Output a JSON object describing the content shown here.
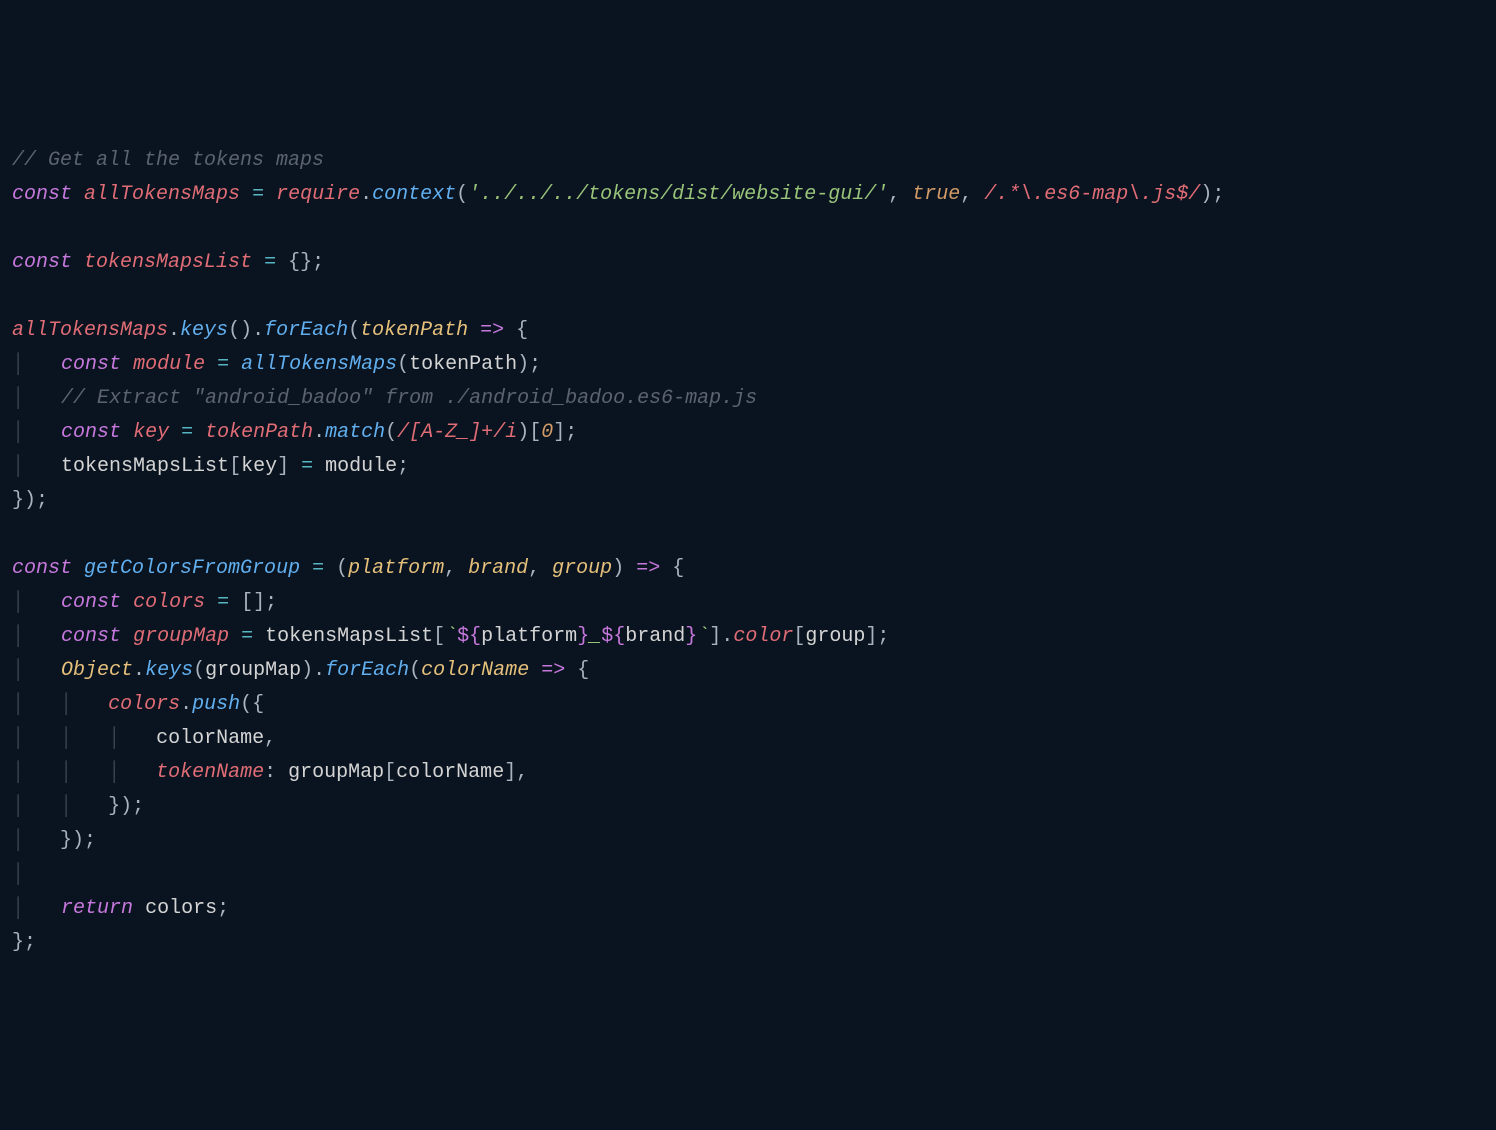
{
  "code": {
    "comment1": "// Get all the tokens maps",
    "l2": {
      "const": "const",
      "allTokensMaps": "allTokensMaps",
      "eq": " = ",
      "require": "require",
      "dot": ".",
      "context": "context",
      "op": "(",
      "string": "'../../../tokens/dist/website-gui/'",
      "comma1": ", ",
      "true": "true",
      "comma2": ", ",
      "regex": "/.*\\.es6-map\\.js$/",
      "cp": ");"
    },
    "l4": {
      "const": "const",
      "tokensMapsList": "tokensMapsList",
      "eq": " = ",
      "braces": "{};"
    },
    "l6": {
      "allTokensMaps": "allTokensMaps",
      "dot1": ".",
      "keys": "keys",
      "parens": "()",
      "dot2": ".",
      "forEach": "forEach",
      "op": "(",
      "tokenPath": "tokenPath",
      "arrow": " => ",
      "brace": "{"
    },
    "l7": {
      "indent": "    ",
      "const": "const",
      "module": "module",
      "eq": " = ",
      "allTokensMaps": "allTokensMaps",
      "op": "(",
      "tokenPath": "tokenPath",
      "cp": ");"
    },
    "l8": {
      "indent": "    ",
      "comment": "// Extract \"android_badoo\" from ./android_badoo.es6-map.js"
    },
    "l9": {
      "indent": "    ",
      "const": "const",
      "key": "key",
      "eq": " = ",
      "tokenPath": "tokenPath",
      "dot": ".",
      "match": "match",
      "op": "(",
      "regex": "/[A-Z_]+/i",
      "cp": ")",
      "bracket_open": "[",
      "zero": "0",
      "bracket_close": "];"
    },
    "l10": {
      "indent": "    ",
      "tokensMapsList": "tokensMapsList",
      "bracket_open": "[",
      "key": "key",
      "bracket_close": "]",
      "eq": " = ",
      "module": "module",
      "semi": ";"
    },
    "l11": {
      "close": "});"
    },
    "l13": {
      "const": "const",
      "getColorsFromGroup": "getColorsFromGroup",
      "eq": " = ",
      "op": "(",
      "platform": "platform",
      "c1": ", ",
      "brand": "brand",
      "c2": ", ",
      "group": "group",
      "cp": ")",
      "arrow": " => ",
      "brace": "{"
    },
    "l14": {
      "indent": "    ",
      "const": "const",
      "colors": "colors",
      "eq": " = ",
      "arr": "[];"
    },
    "l15": {
      "indent": "    ",
      "const": "const",
      "groupMap": "groupMap",
      "eq": " = ",
      "tokensMapsList": "tokensMapsList",
      "bo": "[",
      "tick1": "`",
      "to1": "${",
      "platform": "platform",
      "tc1": "}",
      "underscore": "_",
      "to2": "${",
      "brand": "brand",
      "tc2": "}",
      "tick2": "`",
      "bc": "]",
      "dot": ".",
      "color": "color",
      "bo2": "[",
      "group": "group",
      "bc2": "];"
    },
    "l16": {
      "indent": "    ",
      "Object": "Object",
      "dot1": ".",
      "keys": "keys",
      "op": "(",
      "groupMap": "groupMap",
      "cp": ")",
      "dot2": ".",
      "forEach": "forEach",
      "op2": "(",
      "colorName": "colorName",
      "arrow": " => ",
      "brace": "{"
    },
    "l17": {
      "indent": "        ",
      "colors": "colors",
      "dot": ".",
      "push": "push",
      "op": "(",
      "brace": "{"
    },
    "l18": {
      "indent": "            ",
      "colorName": "colorName",
      "comma": ","
    },
    "l19": {
      "indent": "            ",
      "tokenName": "tokenName",
      "colon": ": ",
      "groupMap": "groupMap",
      "bo": "[",
      "colorName": "colorName",
      "bc": "],"
    },
    "l20": {
      "indent": "        ",
      "close": "});"
    },
    "l21": {
      "indent": "    ",
      "close": "});"
    },
    "l23": {
      "indent": "    ",
      "return": "return",
      "sp": " ",
      "colors": "colors",
      "semi": ";"
    },
    "l24": {
      "close": "};"
    }
  }
}
